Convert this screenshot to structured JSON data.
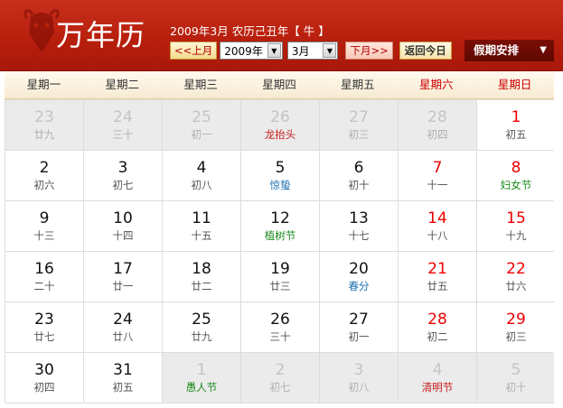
{
  "header": {
    "title": "万年历",
    "date_text": "2009年3月 农历己丑年",
    "zodiac_text": "【 牛 】",
    "prev_month_label": "<<上月",
    "year_value": "2009年",
    "month_value": "3月",
    "next_month_label": "下月>>",
    "today_label": "返回今日",
    "holiday_label": "假期安排",
    "colors": {
      "header_red": "#b81f0d",
      "weekend_red": "#e00000",
      "festival_green": "#1a8a1a",
      "term_blue": "#1a6fb0"
    }
  },
  "weekdays": [
    "星期一",
    "星期二",
    "星期三",
    "星期四",
    "星期五",
    "星期六",
    "星期日"
  ],
  "days": [
    {
      "d": "23",
      "l": "廿九",
      "other": true,
      "weekend": false,
      "kind": ""
    },
    {
      "d": "24",
      "l": "三十",
      "other": true,
      "weekend": false,
      "kind": ""
    },
    {
      "d": "25",
      "l": "初一",
      "other": true,
      "weekend": false,
      "kind": ""
    },
    {
      "d": "26",
      "l": "龙抬头",
      "other": true,
      "weekend": false,
      "kind": "trad"
    },
    {
      "d": "27",
      "l": "初三",
      "other": true,
      "weekend": false,
      "kind": ""
    },
    {
      "d": "28",
      "l": "初四",
      "other": true,
      "weekend": true,
      "kind": ""
    },
    {
      "d": "1",
      "l": "初五",
      "other": false,
      "weekend": true,
      "kind": ""
    },
    {
      "d": "2",
      "l": "初六",
      "other": false,
      "weekend": false,
      "kind": ""
    },
    {
      "d": "3",
      "l": "初七",
      "other": false,
      "weekend": false,
      "kind": ""
    },
    {
      "d": "4",
      "l": "初八",
      "other": false,
      "weekend": false,
      "kind": ""
    },
    {
      "d": "5",
      "l": "惊蛰",
      "other": false,
      "weekend": false,
      "kind": "term"
    },
    {
      "d": "6",
      "l": "初十",
      "other": false,
      "weekend": false,
      "kind": ""
    },
    {
      "d": "7",
      "l": "十一",
      "other": false,
      "weekend": true,
      "kind": ""
    },
    {
      "d": "8",
      "l": "妇女节",
      "other": false,
      "weekend": true,
      "kind": "festival"
    },
    {
      "d": "9",
      "l": "十三",
      "other": false,
      "weekend": false,
      "kind": ""
    },
    {
      "d": "10",
      "l": "十四",
      "other": false,
      "weekend": false,
      "kind": ""
    },
    {
      "d": "11",
      "l": "十五",
      "other": false,
      "weekend": false,
      "kind": ""
    },
    {
      "d": "12",
      "l": "植树节",
      "other": false,
      "weekend": false,
      "kind": "festival"
    },
    {
      "d": "13",
      "l": "十七",
      "other": false,
      "weekend": false,
      "kind": ""
    },
    {
      "d": "14",
      "l": "十八",
      "other": false,
      "weekend": true,
      "kind": ""
    },
    {
      "d": "15",
      "l": "十九",
      "other": false,
      "weekend": true,
      "kind": ""
    },
    {
      "d": "16",
      "l": "二十",
      "other": false,
      "weekend": false,
      "kind": ""
    },
    {
      "d": "17",
      "l": "廿一",
      "other": false,
      "weekend": false,
      "kind": ""
    },
    {
      "d": "18",
      "l": "廿二",
      "other": false,
      "weekend": false,
      "kind": ""
    },
    {
      "d": "19",
      "l": "廿三",
      "other": false,
      "weekend": false,
      "kind": ""
    },
    {
      "d": "20",
      "l": "春分",
      "other": false,
      "weekend": false,
      "kind": "term"
    },
    {
      "d": "21",
      "l": "廿五",
      "other": false,
      "weekend": true,
      "kind": ""
    },
    {
      "d": "22",
      "l": "廿六",
      "other": false,
      "weekend": true,
      "kind": ""
    },
    {
      "d": "23",
      "l": "廿七",
      "other": false,
      "weekend": false,
      "kind": ""
    },
    {
      "d": "24",
      "l": "廿八",
      "other": false,
      "weekend": false,
      "kind": ""
    },
    {
      "d": "25",
      "l": "廿九",
      "other": false,
      "weekend": false,
      "kind": ""
    },
    {
      "d": "26",
      "l": "三十",
      "other": false,
      "weekend": false,
      "kind": ""
    },
    {
      "d": "27",
      "l": "初一",
      "other": false,
      "weekend": false,
      "kind": ""
    },
    {
      "d": "28",
      "l": "初二",
      "other": false,
      "weekend": true,
      "kind": ""
    },
    {
      "d": "29",
      "l": "初三",
      "other": false,
      "weekend": true,
      "kind": ""
    },
    {
      "d": "30",
      "l": "初四",
      "other": false,
      "weekend": false,
      "kind": ""
    },
    {
      "d": "31",
      "l": "初五",
      "other": false,
      "weekend": false,
      "kind": ""
    },
    {
      "d": "1",
      "l": "愚人节",
      "other": true,
      "weekend": false,
      "kind": "festival"
    },
    {
      "d": "2",
      "l": "初七",
      "other": true,
      "weekend": false,
      "kind": ""
    },
    {
      "d": "3",
      "l": "初八",
      "other": true,
      "weekend": false,
      "kind": ""
    },
    {
      "d": "4",
      "l": "清明节",
      "other": true,
      "weekend": true,
      "kind": "trad"
    },
    {
      "d": "5",
      "l": "初十",
      "other": true,
      "weekend": true,
      "kind": ""
    }
  ]
}
